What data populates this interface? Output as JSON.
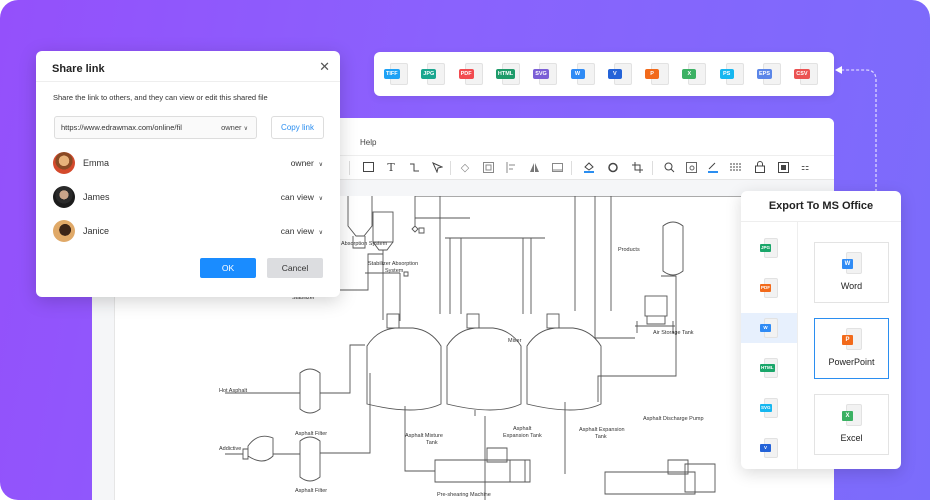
{
  "colors": {
    "background_start": "#9450fb",
    "background_end": "#7b6cfb",
    "primary_blue": "#1a8cff",
    "link_blue": "#2b8ef0"
  },
  "app": {
    "menu": {
      "help_label": "Help"
    },
    "toolbar_icons": [
      "rectangle-icon",
      "text-icon",
      "connector-icon",
      "pointer-icon",
      "layers-icon",
      "group-icon",
      "align-icon",
      "flip-icon",
      "frame-icon",
      "fill-color-icon",
      "shape-style-icon",
      "crop-icon",
      "search-icon",
      "zoom-fit-icon",
      "line-color-icon",
      "line-style-icon",
      "lock-icon",
      "screenshot-icon",
      "more-icon"
    ]
  },
  "diagram": {
    "labels": {
      "absorption_system": "Absorption System",
      "stabilizer_absorption": "Stabilizer Absorption",
      "stabilizer_absorption_2": "System",
      "stabilizer": "Stabilizer",
      "products": "Products",
      "mixer": "Mixer",
      "air_storage_tank": "Air Storage Tank",
      "hot_asphalt": "Hot Asphalt",
      "asphalt_filter_1": "Asphalt Filter",
      "asphalt_filter_2": "Asphalt Filter",
      "addictive": "Addictive",
      "asphalt_mixture_tank_1": "Asphalt Mixture",
      "asphalt_mixture_tank_2": "Tank",
      "asphalt_expansion_tank_a1": "Asphalt",
      "asphalt_expansion_tank_a2": "Expansion Tank",
      "asphalt_expansion_tank_b1": "Asphalt Expansion",
      "asphalt_expansion_tank_b2": "Tank",
      "asphalt_discharge_pump": "Asphalt Discharge  Pump",
      "pre_shearing_machine": "Pre-shearing Machine"
    }
  },
  "format_bar": {
    "formats": [
      {
        "label": "TIFF",
        "color": "#1fa2f5"
      },
      {
        "label": "JPG",
        "color": "#1aa68f"
      },
      {
        "label": "PDF",
        "color": "#f24b50"
      },
      {
        "label": "HTML",
        "color": "#1f9b6a"
      },
      {
        "label": "SVG",
        "color": "#7b5fd6"
      },
      {
        "label": "W",
        "color": "#2f8bf5"
      },
      {
        "label": "V",
        "color": "#2463d8"
      },
      {
        "label": "P",
        "color": "#f26a1b"
      },
      {
        "label": "X",
        "color": "#3bb163"
      },
      {
        "label": "PS",
        "color": "#16b7f0"
      },
      {
        "label": "EPS",
        "color": "#5b86e8"
      },
      {
        "label": "CSV",
        "color": "#eb5252"
      }
    ]
  },
  "share_dialog": {
    "title": "Share link",
    "description": "Share the link to others, and they can view or edit this shared file",
    "link_url": "https://www.edrawmax.com/online/fil",
    "link_permission": "owner",
    "copy_link_label": "Copy link",
    "users": [
      {
        "name": "Emma",
        "permission": "owner"
      },
      {
        "name": "James",
        "permission": "can view"
      },
      {
        "name": "Janice",
        "permission": "can view"
      }
    ],
    "ok_label": "OK",
    "cancel_label": "Cancel"
  },
  "export_panel": {
    "title": "Export To MS Office",
    "side_formats": [
      {
        "label": "JPG",
        "color": "#1aa66a",
        "active": false
      },
      {
        "label": "PDF",
        "color": "#f26a1b",
        "active": false
      },
      {
        "label": "W",
        "color": "#2f8bf5",
        "active": true
      },
      {
        "label": "HTML",
        "color": "#1aa66a",
        "active": false
      },
      {
        "label": "SVG",
        "color": "#16b7f0",
        "active": false
      },
      {
        "label": "V",
        "color": "#2463d8",
        "active": false
      }
    ],
    "options": [
      {
        "label": "Word",
        "tag": "W",
        "color": "#2f8bf5",
        "selected": false
      },
      {
        "label": "PowerPoint",
        "tag": "P",
        "color": "#f26a1b",
        "selected": true
      },
      {
        "label": "Excel",
        "tag": "X",
        "color": "#3bb163",
        "selected": false
      }
    ]
  }
}
